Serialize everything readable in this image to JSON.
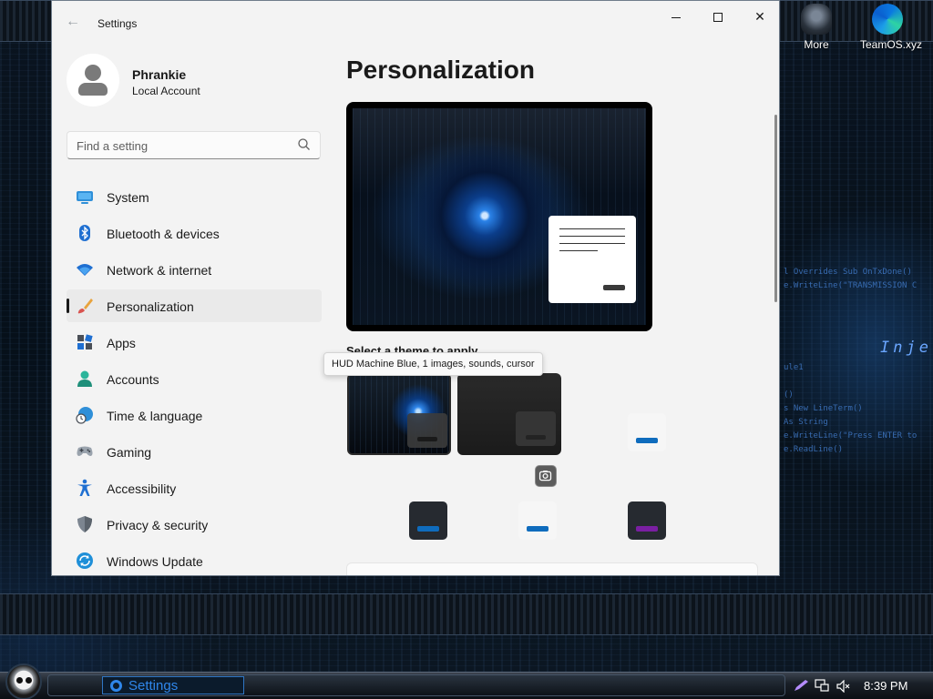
{
  "window": {
    "title": "Settings"
  },
  "user": {
    "name": "Phrankie",
    "account_type": "Local Account"
  },
  "search": {
    "placeholder": "Find a setting"
  },
  "nav": {
    "items": [
      {
        "label": "System",
        "icon": "monitor-icon"
      },
      {
        "label": "Bluetooth & devices",
        "icon": "bluetooth-icon"
      },
      {
        "label": "Network & internet",
        "icon": "wifi-icon"
      },
      {
        "label": "Personalization",
        "icon": "paintbrush-icon",
        "selected": true
      },
      {
        "label": "Apps",
        "icon": "apps-icon"
      },
      {
        "label": "Accounts",
        "icon": "person-icon"
      },
      {
        "label": "Time & language",
        "icon": "globe-clock-icon"
      },
      {
        "label": "Gaming",
        "icon": "gamepad-icon"
      },
      {
        "label": "Accessibility",
        "icon": "accessibility-icon"
      },
      {
        "label": "Privacy & security",
        "icon": "shield-icon"
      },
      {
        "label": "Windows Update",
        "icon": "update-icon"
      }
    ]
  },
  "main": {
    "page_title": "Personalization",
    "theme_section_label": "Select a theme to apply",
    "theme_tooltip": "HUD Machine Blue, 1 images, sounds, cursor"
  },
  "desktop": {
    "icons": [
      {
        "label": "More",
        "icon": "alien-head-icon"
      },
      {
        "label": "TeamOS.xyz",
        "icon": "edge-browser-icon"
      }
    ],
    "code_lines": [
      "l Overrides Sub OnTxDone()",
      "e.WriteLine(\"TRANSMISSION C",
      "ule1",
      "()",
      "s New LineTerm()",
      "As String",
      "e.WriteLine(\"Press ENTER to",
      "e.ReadLine()"
    ],
    "inject_text": "Inje"
  },
  "taskbar": {
    "active_app": "Settings",
    "time": "8:39 PM"
  },
  "colors": {
    "accent": "#0f6cbd",
    "selected_nav_bg": "#eaeaea",
    "window_bg": "#f3f3f3",
    "taskbar_highlight": "#2f86ea"
  }
}
